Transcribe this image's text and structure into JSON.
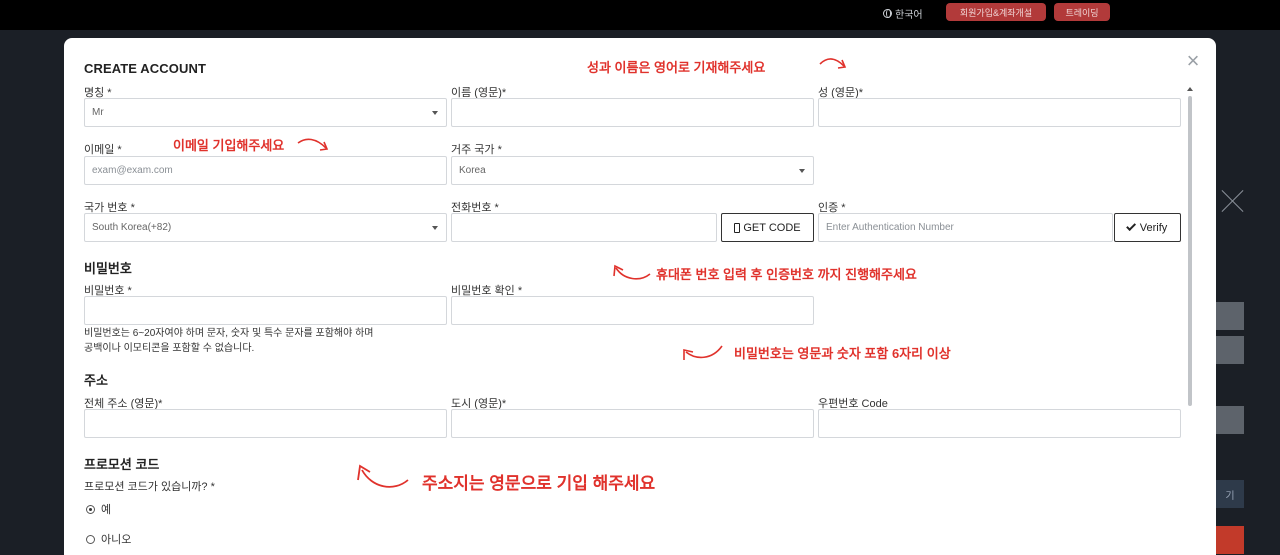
{
  "topbar": {
    "language": "한국어",
    "signup_button": "회원가입&계좌개설",
    "trade_button": "트레이딩"
  },
  "background": {
    "side_button_label": "기"
  },
  "modal": {
    "title": "CREATE ACCOUNT",
    "fields": {
      "title_label": "명칭 *",
      "title_value": "Mr",
      "first_name_label": "이름 (영문)*",
      "last_name_label": "성 (영문)*",
      "email_label": "이메일 *",
      "email_placeholder": "exam@exam.com",
      "country_label": "거주 국가 *",
      "country_value": "Korea",
      "country_code_label": "국가 번호 *",
      "country_code_value": "South Korea(+82)",
      "phone_label": "전화번호 *",
      "get_code_button": "GET CODE",
      "auth_label": "인증 *",
      "auth_placeholder": "Enter Authentication Number",
      "verify_button": "Verify"
    },
    "password_section": {
      "heading": "비밀번호",
      "password_label": "비밀번호 *",
      "confirm_label": "비밀번호 확인 *",
      "help_line1": "비밀번호는 6~20자여야 하며 문자, 숫자 및 특수 문자를 포함해야 하며",
      "help_line2": "공백이나 이모티콘을 포함할 수 없습니다."
    },
    "address_section": {
      "heading": "주소",
      "full_address_label": "전체 주소 (영문)*",
      "city_label": "도시 (영문)*",
      "postal_label": "우편번호 Code"
    },
    "promo_section": {
      "heading": "프로모션 코드",
      "question": "프로모션 코드가 있습니까? *",
      "option_yes": "예",
      "option_no": "아니오",
      "selected": "예"
    }
  },
  "annotations": {
    "name_note": "성과 이름은 영어로 기재해주세요",
    "email_note": "이메일 기입해주세요",
    "phone_note": "휴대폰 번호 입력 후  인증번호 까지 진행해주세요",
    "password_note": "비밀번호는 영문과 숫자 포함 6자리 이상",
    "address_note": "주소지는 영문으로 기입 해주세요",
    "color": "#e0322c"
  }
}
